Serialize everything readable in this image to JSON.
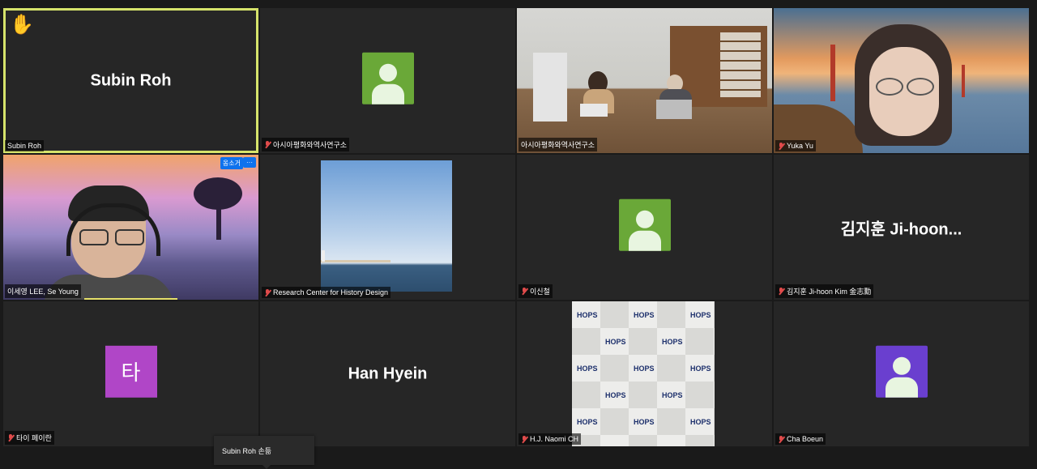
{
  "tiles": [
    {
      "name": "Subin Roh",
      "display": "Subin Roh",
      "label": "Subin Roh"
    },
    {
      "name": "아시아평화와역사연구소",
      "label": "아시아평화와역사연구소"
    },
    {
      "name": "아시아평화와역사연구소",
      "label": "아시아평화와역사연구소"
    },
    {
      "name": "Yuka Yu",
      "label": "Yuka Yu"
    },
    {
      "name": "이세영 LEE, Se Young",
      "label": "이세영 LEE, Se Young",
      "badge": "옹소거",
      "more": "···"
    },
    {
      "name": "Research Center for History Design",
      "label": "Research Center for History Design"
    },
    {
      "name": "이신철",
      "label": "이신철"
    },
    {
      "name": "김지훈 Ji-hoon Kim 金志勳",
      "display": "김지훈 Ji-hoon...",
      "label": "김지훈 Ji-hoon Kim 金志勳"
    },
    {
      "name": "타이 페이란",
      "avatar_letter": "타",
      "label": "타이 페이란"
    },
    {
      "name": "Han Hyein",
      "display": "Han Hyein",
      "label": ""
    },
    {
      "name": "H.J. Naomi CH",
      "label": "H.J. Naomi CH"
    },
    {
      "name": "Cha Boeun",
      "label": "Cha Boeun"
    }
  ],
  "hops_logo": "HOPS",
  "tooltip": "Subin Roh 손듦",
  "colors": {
    "active_border": "#d6e36b",
    "avatar_green": "#6aa838",
    "avatar_purple": "#6a3fcf",
    "letter_avatar": "#b046c7",
    "badge_blue": "#0e72ed",
    "mic_muted": "#e04b4b"
  },
  "icons": {
    "raised_hand": "raised-hand-icon",
    "mic": "mic-muted-icon",
    "person": "person-icon"
  }
}
